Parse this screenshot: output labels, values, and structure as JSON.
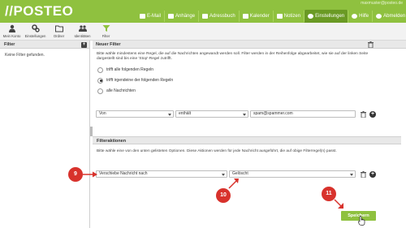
{
  "app": {
    "logo": "//POSTEO",
    "account": "maxmuster@posteo.de"
  },
  "nav": [
    {
      "label": "E-Mail",
      "icon": "mail-icon",
      "active": false
    },
    {
      "label": "Anhänge",
      "icon": "paperclip-icon",
      "active": false
    },
    {
      "label": "Adressbuch",
      "icon": "addressbook-icon",
      "active": false
    },
    {
      "label": "Kalender",
      "icon": "calendar-icon",
      "active": false
    },
    {
      "label": "Notizen",
      "icon": "notes-icon",
      "active": false
    },
    {
      "label": "Einstellungen",
      "icon": "gear-icon",
      "active": true
    },
    {
      "label": "Hilfe",
      "icon": "help-icon",
      "active": false
    },
    {
      "label": "Abmelden",
      "icon": "power-icon",
      "active": false
    }
  ],
  "toolbar": [
    {
      "label": "Mein Konto",
      "icon": "person-icon"
    },
    {
      "label": "Einstellungen",
      "icon": "gears-icon"
    },
    {
      "label": "Ordner",
      "icon": "folder-icon"
    },
    {
      "label": "Identitäten",
      "icon": "identities-icon"
    },
    {
      "label": "Filter",
      "icon": "funnel-icon"
    }
  ],
  "sidebar": {
    "title": "Filter",
    "add_label": "+",
    "empty_text": "Keine Filter gefunden."
  },
  "main": {
    "title": "Neuer Filter",
    "description": "Bitte wähle mindestens eine Regel, die auf die Nachrichten angewandt werden soll. Filter werden in der Reihenfolge abgearbeitet, wie sie auf der linken Seite dargestellt sind bis eine 'Stop'-Regel zutrifft.",
    "radios": [
      {
        "label": "trifft alle folgenden Regeln",
        "checked": false
      },
      {
        "label": "trifft irgendeine der folgenden Regeln",
        "checked": true
      },
      {
        "label": "alle Nachrichten",
        "checked": false
      }
    ],
    "rule": {
      "field": "Von",
      "operator": "enthält",
      "value": "spam@spammer.com"
    },
    "actions_title": "Filteraktionen",
    "actions_description": "Bitte wähle eine von den unten gelisteten Optionen. Diese Aktionen werden für jede Nachricht ausgeführt, die auf obige Filterregel(n) passt.",
    "action": {
      "type": "Verschiebe Nachricht nach",
      "target": "Gelöscht"
    },
    "save_label": "Speichern"
  },
  "callouts": [
    "9",
    "10",
    "11"
  ],
  "colors": {
    "brand_green": "#8fc13f",
    "active_green": "#6a9a24",
    "callout_red": "#d8322c"
  }
}
